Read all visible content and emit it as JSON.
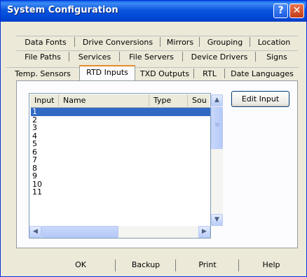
{
  "window": {
    "title": "System Configuration"
  },
  "titlebar": {
    "help_glyph": "?",
    "close_glyph": "✕"
  },
  "tabs": {
    "row1": [
      "Data Fonts",
      "Drive Conversions",
      "Mirrors",
      "Grouping",
      "Location"
    ],
    "row2": [
      "File Paths",
      "Services",
      "File Servers",
      "Device Drivers",
      "Signs"
    ],
    "row3": [
      "Temp. Sensors",
      "RTD Inputs",
      "TXD Outputs",
      "RTL",
      "Date Languages"
    ],
    "active": "RTD Inputs"
  },
  "list": {
    "columns": [
      "Input",
      "Name",
      "Type",
      "Sou"
    ],
    "rows": [
      "1",
      "2",
      "3",
      "4",
      "5",
      "6",
      "7",
      "8",
      "9",
      "10",
      "11"
    ],
    "selected": "1"
  },
  "scroll": {
    "up": "▲",
    "down": "▼",
    "left": "◀",
    "right": "▶",
    "grip": "≡"
  },
  "buttons": {
    "edit_input": "Edit Input"
  },
  "footer": {
    "ok": "OK",
    "backup": "Backup",
    "print": "Print",
    "help": "Help"
  },
  "colors": {
    "title_bar": "#0a55df",
    "selection": "#316ac5",
    "active_tab_accent": "#e68b2c"
  }
}
